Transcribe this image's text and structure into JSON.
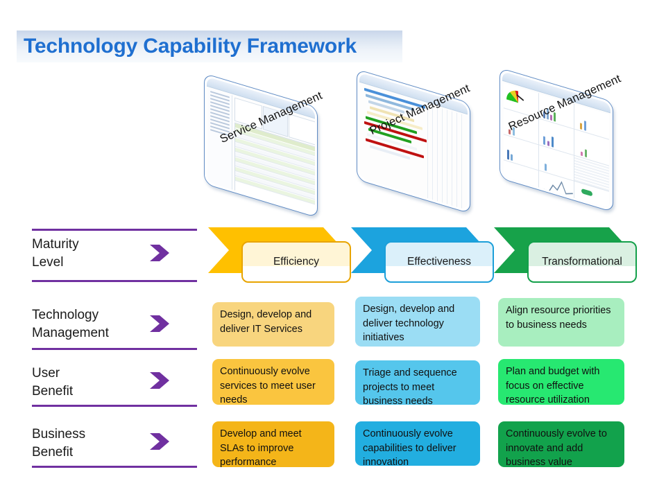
{
  "title": "Technology Capability Framework",
  "columns": [
    {
      "key": "service",
      "thumb_label": "Service Management",
      "maturity": "Efficiency",
      "accent": "#FFC000",
      "arrow_color": "#FFC000",
      "pill_border": "#E8A400",
      "cards": [
        {
          "row": "technology_management",
          "text": "Design, develop and deliver IT Services",
          "bg": "#F8D57E"
        },
        {
          "row": "user_benefit",
          "text": "Continuously evolve services to meet user needs",
          "bg": "#FAC53F"
        },
        {
          "row": "business_benefit",
          "text": "Develop and meet SLAs to improve performance",
          "bg": "#F4B519"
        }
      ]
    },
    {
      "key": "project",
      "thumb_label": "Project Management",
      "maturity": "Effectiveness",
      "accent": "#1CA3DE",
      "arrow_color": "#1CA3DE",
      "pill_border": "#1C9FD9",
      "cards": [
        {
          "row": "technology_management",
          "text": "Design, develop and deliver technology initiatives",
          "bg": "#9BDDF4"
        },
        {
          "row": "user_benefit",
          "text": "Triage and sequence projects to meet business needs",
          "bg": "#55C6EC"
        },
        {
          "row": "business_benefit",
          "text": "Continuously evolve capabilities to deliver innovation",
          "bg": "#22AEE0"
        }
      ]
    },
    {
      "key": "resource",
      "thumb_label": "Resource Management",
      "maturity": "Transformational",
      "accent": "#17A24A",
      "arrow_color": "#17A24A",
      "pill_border": "#13A04A",
      "cards": [
        {
          "row": "technology_management",
          "text": "Align resource priorities to business needs",
          "bg": "#A8EEBF"
        },
        {
          "row": "user_benefit",
          "text": "Plan and budget with focus on effective resource utilization",
          "bg": "#27E871"
        },
        {
          "row": "business_benefit",
          "text": "Continuously evolve to innovate and add business value",
          "bg": "#12A24C"
        }
      ]
    }
  ],
  "rows": [
    {
      "key": "maturity_level",
      "line1": "Maturity",
      "line2": "Level"
    },
    {
      "key": "technology_management",
      "line1": "Technology",
      "line2": "Management"
    },
    {
      "key": "user_benefit",
      "line1": "User",
      "line2": "Benefit"
    },
    {
      "key": "business_benefit",
      "line1": "Business",
      "line2": "Benefit"
    }
  ],
  "theme": {
    "rule_color": "#7030A0",
    "chevron_color": "#7030A0",
    "title_color": "#1F6FD0",
    "title_band_color": "#C9D6EA"
  }
}
